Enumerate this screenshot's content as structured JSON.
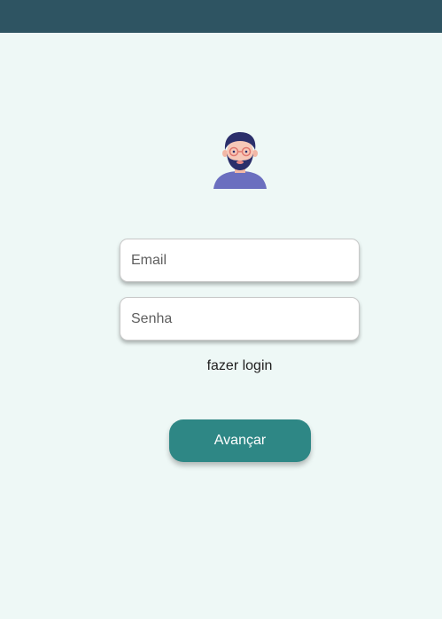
{
  "header": {
    "background": "#2e5462"
  },
  "avatar": {
    "icon": "user-avatar-icon"
  },
  "form": {
    "email_placeholder": "Email",
    "email_value": "",
    "password_placeholder": "Senha",
    "password_value": "",
    "login_link": "fazer login",
    "submit_label": "Avançar",
    "accent": "#2e8785"
  }
}
